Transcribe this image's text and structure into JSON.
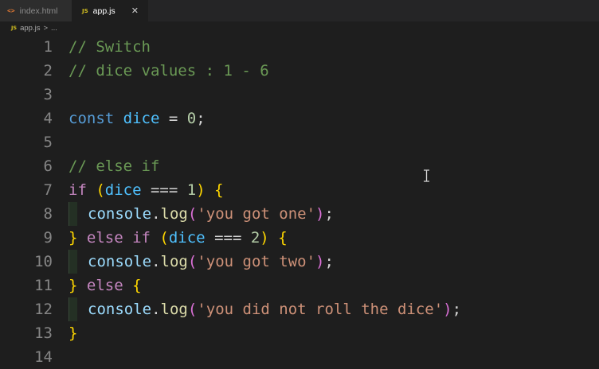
{
  "tabs": [
    {
      "label": "index.html",
      "icon": "html-file-icon",
      "icon_glyph": "<>",
      "active": false
    },
    {
      "label": "app.js",
      "icon": "js-file-icon",
      "icon_glyph": "JS",
      "active": true,
      "close_glyph": "✕"
    }
  ],
  "breadcrumb": {
    "icon_glyph": "JS",
    "file": "app.js",
    "separator": ">",
    "rest": "..."
  },
  "editor": {
    "lines": [
      {
        "n": "1",
        "tokens": [
          {
            "t": "// Switch",
            "c": "t-comment"
          }
        ]
      },
      {
        "n": "2",
        "tokens": [
          {
            "t": "// dice values : 1 - 6",
            "c": "t-comment"
          }
        ]
      },
      {
        "n": "3",
        "tokens": []
      },
      {
        "n": "4",
        "tokens": [
          {
            "t": "const ",
            "c": "t-keyword"
          },
          {
            "t": "dice",
            "c": "t-var"
          },
          {
            "t": " = ",
            "c": "t-op"
          },
          {
            "t": "0",
            "c": "t-num"
          },
          {
            "t": ";",
            "c": "t-punc"
          }
        ]
      },
      {
        "n": "5",
        "tokens": []
      },
      {
        "n": "6",
        "tokens": [
          {
            "t": "// else if",
            "c": "t-comment"
          }
        ]
      },
      {
        "n": "7",
        "tokens": [
          {
            "t": "if ",
            "c": "t-control"
          },
          {
            "t": "(",
            "c": "t-paren"
          },
          {
            "t": "dice",
            "c": "t-var"
          },
          {
            "t": " === ",
            "c": "t-op"
          },
          {
            "t": "1",
            "c": "t-num"
          },
          {
            "t": ")",
            "c": "t-paren"
          },
          {
            "t": " ",
            "c": "t-plain"
          },
          {
            "t": "{",
            "c": "t-brace"
          }
        ]
      },
      {
        "n": "8",
        "indent": true,
        "tokens": [
          {
            "t": "console",
            "c": "t-obj"
          },
          {
            "t": ".",
            "c": "t-punc"
          },
          {
            "t": "log",
            "c": "t-func"
          },
          {
            "t": "(",
            "c": "t-paren2"
          },
          {
            "t": "'you got one'",
            "c": "t-str"
          },
          {
            "t": ")",
            "c": "t-paren2"
          },
          {
            "t": ";",
            "c": "t-punc"
          }
        ]
      },
      {
        "n": "9",
        "tokens": [
          {
            "t": "}",
            "c": "t-brace"
          },
          {
            "t": " else if ",
            "c": "t-control"
          },
          {
            "t": "(",
            "c": "t-paren"
          },
          {
            "t": "dice",
            "c": "t-var"
          },
          {
            "t": " === ",
            "c": "t-op"
          },
          {
            "t": "2",
            "c": "t-num"
          },
          {
            "t": ")",
            "c": "t-paren"
          },
          {
            "t": " ",
            "c": "t-plain"
          },
          {
            "t": "{",
            "c": "t-brace"
          }
        ]
      },
      {
        "n": "10",
        "indent": true,
        "tokens": [
          {
            "t": "console",
            "c": "t-obj"
          },
          {
            "t": ".",
            "c": "t-punc"
          },
          {
            "t": "log",
            "c": "t-func"
          },
          {
            "t": "(",
            "c": "t-paren2"
          },
          {
            "t": "'you got two'",
            "c": "t-str"
          },
          {
            "t": ")",
            "c": "t-paren2"
          },
          {
            "t": ";",
            "c": "t-punc"
          }
        ]
      },
      {
        "n": "11",
        "tokens": [
          {
            "t": "}",
            "c": "t-brace"
          },
          {
            "t": " else ",
            "c": "t-control"
          },
          {
            "t": "{",
            "c": "t-brace"
          }
        ]
      },
      {
        "n": "12",
        "indent": true,
        "tokens": [
          {
            "t": "console",
            "c": "t-obj"
          },
          {
            "t": ".",
            "c": "t-punc"
          },
          {
            "t": "log",
            "c": "t-func"
          },
          {
            "t": "(",
            "c": "t-paren2"
          },
          {
            "t": "'you did not roll the dice'",
            "c": "t-str"
          },
          {
            "t": ")",
            "c": "t-paren2"
          },
          {
            "t": ";",
            "c": "t-punc"
          }
        ]
      },
      {
        "n": "13",
        "tokens": [
          {
            "t": "}",
            "c": "t-brace"
          }
        ]
      },
      {
        "n": "14",
        "tokens": []
      }
    ]
  },
  "colors": {
    "background": "#1e1e1e",
    "tabbar": "#252526",
    "comment": "#6a9955",
    "keyword": "#569cd6",
    "control": "#c586c0",
    "string": "#ce9178",
    "variable": "#4fc1ff",
    "number": "#b5cea8",
    "function": "#dcdcaa",
    "bracket": "#ffd700"
  }
}
